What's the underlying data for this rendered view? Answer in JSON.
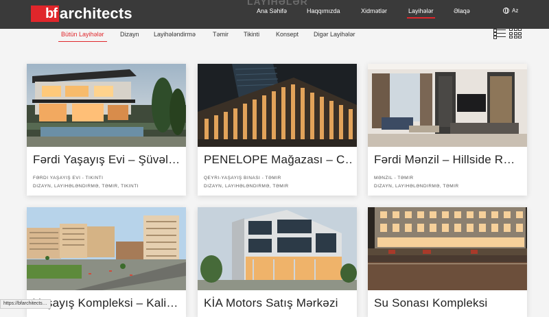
{
  "header": {
    "logo_mark": "bf",
    "logo_text": "architects",
    "ghost_heading": "LAYIHƏLƏR",
    "nav": [
      {
        "label": "Ana Səhifə"
      },
      {
        "label": "Haqqımızda"
      },
      {
        "label": "Xidmətlər"
      },
      {
        "label": "Layihələr",
        "active": true
      },
      {
        "label": "Əlaqə"
      }
    ],
    "language": "Az"
  },
  "filters": [
    {
      "label": "Bütün Layihələr",
      "active": true
    },
    {
      "label": "Dizayn"
    },
    {
      "label": "Layihələndirmə"
    },
    {
      "label": "Təmir"
    },
    {
      "label": "Tikinti"
    },
    {
      "label": "Konsept"
    },
    {
      "label": "Digər Layihələr"
    }
  ],
  "projects": [
    {
      "title": "Fərdi Yaşayış Evi – Şüvəl…",
      "category": "Fərdi yaşayış evi - Tikinti",
      "tags": "Dizayn, Layihələndirmə, Təmir, Tikinti"
    },
    {
      "title": "PENELOPE Mağazası – C…",
      "category": "Qeyri-yaşayış binası - Təmir",
      "tags": "Dizayn, Layihələndirmə, Təmir"
    },
    {
      "title": "Fərdi Mənzil – Hillside R…",
      "category": "Mənzil - Təmir",
      "tags": "Dizayn, Layihələndirmə, Təmir"
    },
    {
      "title": "Yaşayış Kompleksi – Kali…",
      "category": "",
      "tags": ""
    },
    {
      "title": "KİA Motors Satış Mərkəzi",
      "category": "",
      "tags": ""
    },
    {
      "title": "Su Sonası Kompleksi",
      "category": "",
      "tags": ""
    }
  ],
  "status_url": "https://bfarchitects…"
}
